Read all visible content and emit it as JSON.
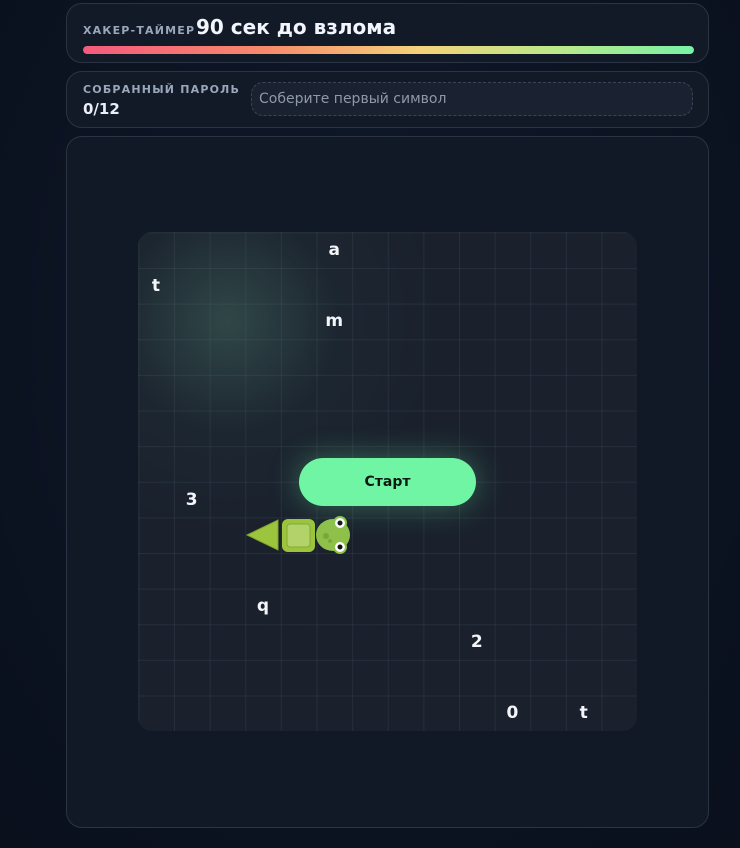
{
  "timer": {
    "label": "ХАКЕР-ТАЙМЕР",
    "value": "90 сек до взлома",
    "progress": 1.0
  },
  "password": {
    "label": "СОБРАННЫЙ ПАРОЛЬ",
    "count": "0/12",
    "placeholder": "Соберите первый символ"
  },
  "board": {
    "columns": 14,
    "rows": 14,
    "letters": [
      {
        "char": "a",
        "col": 5,
        "row": 0
      },
      {
        "char": "t",
        "col": 0,
        "row": 1
      },
      {
        "char": "m",
        "col": 5,
        "row": 2
      },
      {
        "char": "3",
        "col": 1,
        "row": 7
      },
      {
        "char": "q",
        "col": 3,
        "row": 10
      },
      {
        "char": "2",
        "col": 9,
        "row": 11
      },
      {
        "char": "0",
        "col": 10,
        "row": 13
      },
      {
        "char": "t",
        "col": 12,
        "row": 13
      }
    ],
    "snake": {
      "head_icon": "frog-head-icon",
      "body_icon": "snake-body-segment-icon",
      "tail_icon": "snake-tail-icon",
      "direction": "right",
      "color": "#9cc43c"
    }
  },
  "start_button": {
    "label": "Старт",
    "color": "#6ff5a4"
  }
}
